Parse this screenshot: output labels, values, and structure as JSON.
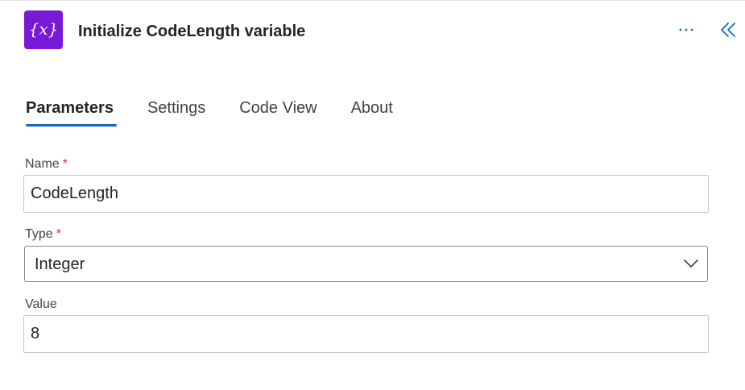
{
  "header": {
    "title": "Initialize CodeLength variable",
    "icon": "variable-icon",
    "icon_color": "#7719d6",
    "more_icon": "more-horizontal-icon",
    "collapse_icon": "double-chevron-left-icon"
  },
  "tabs": [
    {
      "label": "Parameters",
      "active": true
    },
    {
      "label": "Settings",
      "active": false
    },
    {
      "label": "Code View",
      "active": false
    },
    {
      "label": "About",
      "active": false
    }
  ],
  "fields": {
    "name": {
      "label": "Name",
      "required_mark": "*",
      "value": "CodeLength"
    },
    "type": {
      "label": "Type",
      "required_mark": "*",
      "value": "Integer"
    },
    "value": {
      "label": "Value",
      "value": "8"
    }
  },
  "colors": {
    "accent": "#0f6cbd",
    "required": "#c4314b"
  }
}
